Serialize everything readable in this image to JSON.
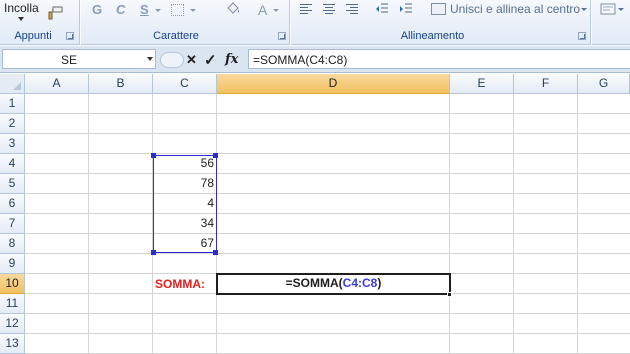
{
  "ribbon": {
    "paste_label": "Incolla",
    "bold": "G",
    "italic": "C",
    "underline": "S",
    "font_color_icon": "A",
    "wrap_merge": "Unisci e allinea al centro",
    "groups": [
      "Appunti",
      "Carattere",
      "Allineamento"
    ]
  },
  "formula_bar": {
    "name_box": "SE",
    "cancel_icon": "✕",
    "enter_icon": "✓",
    "fx": "fx",
    "formula": "=SOMMA(C4:C8)"
  },
  "sheet": {
    "columns": [
      "A",
      "B",
      "C",
      "D",
      "E",
      "F",
      "G"
    ],
    "selected_column": "D",
    "rows": [
      "1",
      "2",
      "3",
      "4",
      "5",
      "6",
      "7",
      "8",
      "9",
      "10",
      "11",
      "12",
      "13"
    ],
    "selected_row": "10",
    "values_c": [
      "56",
      "78",
      "4",
      "34",
      "67"
    ],
    "label_b10": "SOMMA:",
    "d10_prefix": "=SOMMA(",
    "d10_ref": "C4:C8",
    "d10_suffix": ")"
  },
  "colors": {
    "somma_label": "#e02020",
    "range_ref": "#3a3aee",
    "header_selected": "#f1c15f"
  }
}
